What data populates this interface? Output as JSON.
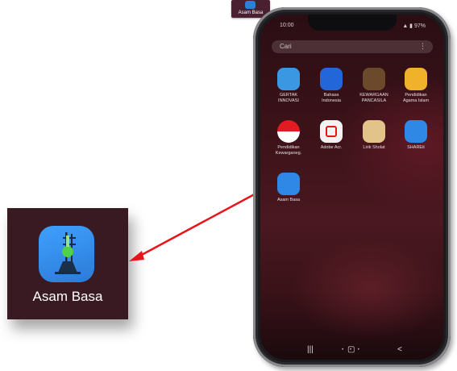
{
  "thumbnail": {
    "label": "Asam Basa"
  },
  "zoom": {
    "label": "Asam Basa",
    "icon": "lab-burette-icon"
  },
  "phone": {
    "status": {
      "time": "10:00",
      "right": "▲ ▮ 97%"
    },
    "search": {
      "placeholder": "Cari",
      "menu_icon": "⋮"
    },
    "apps": [
      {
        "label": "GERTAK\nINNOVASI",
        "icon": "molecule-icon",
        "color": "#3a97e2"
      },
      {
        "label": "Bahasa\nIndonesia",
        "icon": "book-icon",
        "color": "#2366d9"
      },
      {
        "label": "KEWARGAAN\nPANCASILA",
        "icon": "garuda-icon",
        "color": "#6a4a2a"
      },
      {
        "label": "Pendidikan\nAgama Islam",
        "icon": "crescent-icon",
        "color": "#f0b22a"
      },
      {
        "label": "Pendidikan\nKewarganeg.",
        "icon": "flag-icon",
        "color": "#ffffff"
      },
      {
        "label": "Adobe Acr.",
        "icon": "acrobat-icon",
        "color": "#1a1a1a"
      },
      {
        "label": "Lirik Sholat",
        "icon": "prayer-icon",
        "color": "#e2c48a"
      },
      {
        "label": "SHAREit",
        "icon": "share-icon",
        "color": "#2f87e6"
      },
      {
        "label": "Asam Basa",
        "icon": "lab-burette-icon",
        "color": "#2f87e6"
      }
    ],
    "nav": {
      "recent": "|||",
      "home": "▢",
      "back": "<"
    }
  },
  "colors": {
    "arrow": "#e8141b",
    "zoom_card": "#3a1a22",
    "app_icon": "#2f87e6"
  }
}
